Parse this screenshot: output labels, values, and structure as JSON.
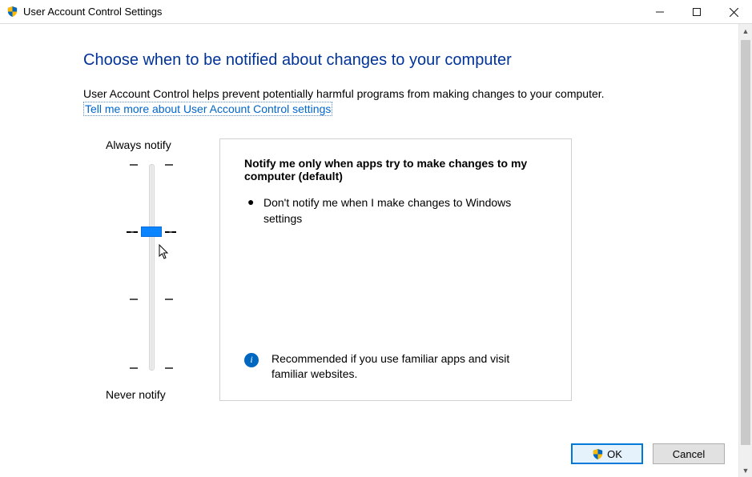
{
  "window": {
    "title": "User Account Control Settings"
  },
  "page": {
    "heading": "Choose when to be notified about changes to your computer",
    "description": "User Account Control helps prevent potentially harmful programs from making changes to your computer.",
    "help_link": "Tell me more about User Account Control settings"
  },
  "slider": {
    "top_label": "Always notify",
    "bottom_label": "Never notify",
    "levels": 4,
    "selected_index": 1
  },
  "panel": {
    "title": "Notify me only when apps try to make changes to my computer (default)",
    "bullet1": "Don't notify me when I make changes to Windows settings",
    "recommendation": "Recommended if you use familiar apps and visit familiar websites."
  },
  "buttons": {
    "ok": "OK",
    "cancel": "Cancel"
  }
}
